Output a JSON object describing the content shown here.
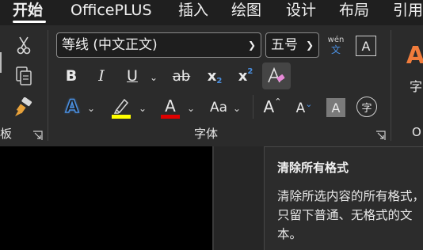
{
  "tabs": [
    "开始",
    "OfficePLUS",
    "插入",
    "绘图",
    "设计",
    "布局",
    "引用"
  ],
  "font_group": {
    "label": "字体",
    "font_name": "等线 (中文正文)",
    "font_size": "五号",
    "phonetic_top": "wén",
    "phonetic_bottom": "文",
    "char_border": "A",
    "bold": "B",
    "italic": "I",
    "underline": "U",
    "strike": "ab",
    "subscript": "x",
    "subscript_mark": "2",
    "superscript": "x",
    "superscript_mark": "2",
    "text_effects": "A",
    "font_color": "A",
    "change_case": "Aa",
    "grow_font": "A",
    "shrink_font": "A",
    "char_shading": "A",
    "enclose_char": "字",
    "highlight_color": "#ffff00",
    "font_color_value": "#e00000"
  },
  "left_group": {
    "label_partial": "板"
  },
  "right_group": {
    "label_partial": "O",
    "glyph": "字"
  },
  "tooltip": {
    "title": "清除所有格式",
    "description": "清除所选内容的所有格式，只留下普通、无格式的文本。"
  },
  "colors": {
    "accent_blue": "#4a8fe0",
    "ribbon_bg": "#2b2b2b",
    "right_orange": "#f07c3c"
  }
}
